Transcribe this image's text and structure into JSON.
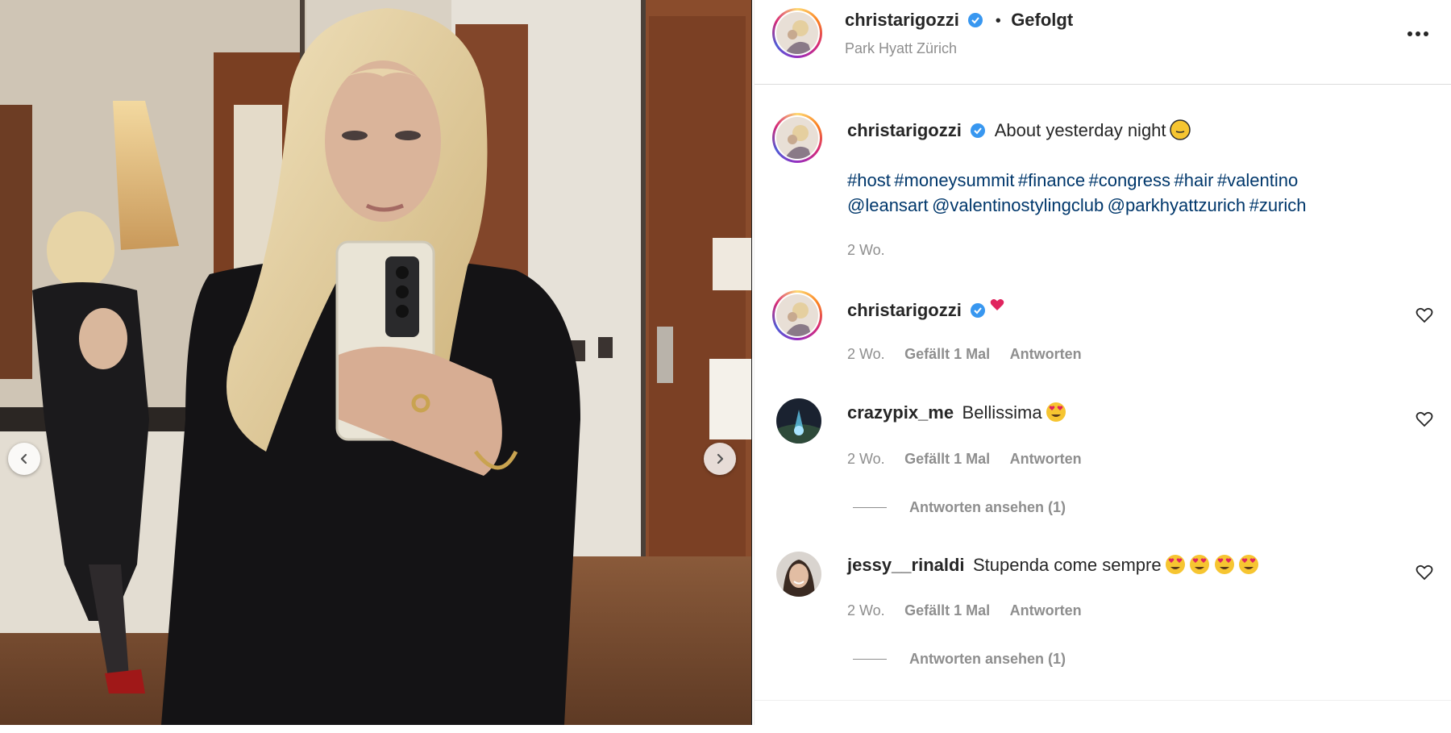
{
  "post": {
    "username": "christarigozzi",
    "follow_state": "Gefolgt",
    "location": "Park Hyatt Zürich",
    "caption_text": "About yesterday night",
    "caption_tags_line1": [
      "#host",
      "#moneysummit",
      "#finance",
      "#congress",
      "#hair",
      "#valentino"
    ],
    "caption_tags_line2": [
      "@leansart",
      "@valentinostylingclub",
      "@parkhyattzurich",
      "#zurich"
    ],
    "caption_time": "2 Wo."
  },
  "comments": [
    {
      "username": "christarigozzi",
      "text": "",
      "time": "2 Wo.",
      "likes": "Gefällt 1 Mal",
      "reply": "Antworten"
    },
    {
      "username": "crazypix_me",
      "text": "Bellissima",
      "time": "2 Wo.",
      "likes": "Gefällt 1 Mal",
      "reply": "Antworten",
      "view_replies": "Antworten ansehen (1)"
    },
    {
      "username": "jessy__rinaldi",
      "text": "Stupenda come sempre",
      "time": "2 Wo.",
      "likes": "Gefällt 1 Mal",
      "reply": "Antworten",
      "view_replies": "Antworten ansehen (1)"
    }
  ],
  "colors": {
    "link": "#00376b",
    "verified": "#3897f0",
    "meta": "#8e8e8e",
    "text": "#262626"
  },
  "icons": [
    "chevron-left-icon",
    "chevron-right-icon",
    "more-horizontal-icon",
    "verified-badge-icon",
    "heart-icon",
    "red-heart-icon",
    "face-emoji-icon",
    "heart-eyes-emoji-icon"
  ]
}
